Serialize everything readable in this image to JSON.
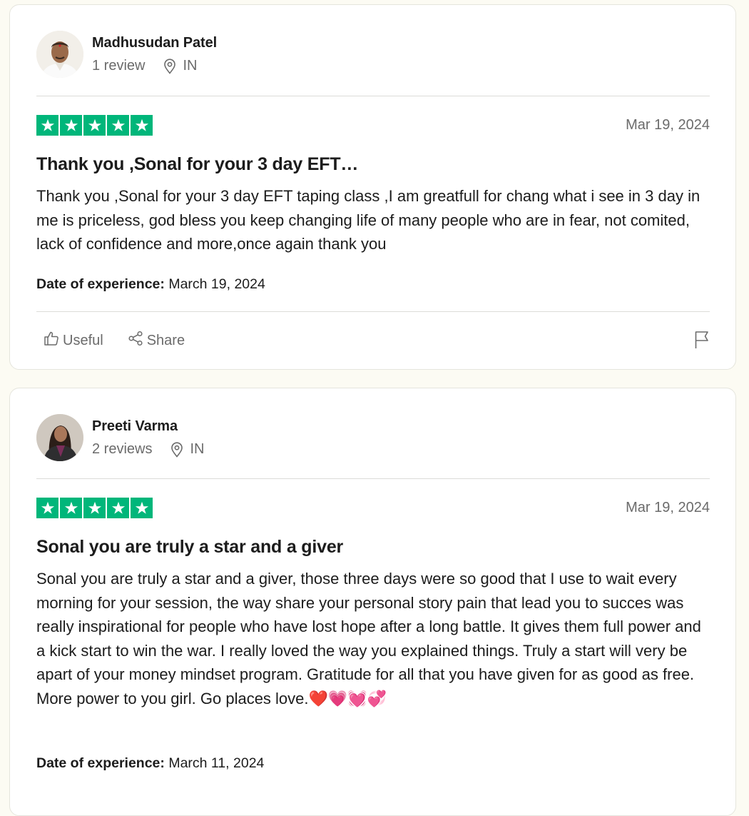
{
  "colors": {
    "star_green": "#00b67a",
    "muted_text": "#6b6b6b",
    "page_bg": "#fcfbf3"
  },
  "icons": {
    "location": "map-pin-icon",
    "useful": "thumbs-up-icon",
    "share": "share-icon",
    "report": "flag-icon",
    "star": "star-icon"
  },
  "reviews": [
    {
      "name": "Madhusudan Patel",
      "review_count": "1 review",
      "country": "IN",
      "rating": 5,
      "date": "Mar 19, 2024",
      "title": "Thank you ,Sonal for your 3 day EFT…",
      "body": "Thank you ,Sonal for your 3 day EFT taping class ,I am greatfull for chang what i see in 3 day in me is priceless, god bless you keep changing life of many people who are in fear, not comited, lack of confidence and more,once again thank you",
      "experience_label": "Date of experience:",
      "experience_date": "March 19, 2024",
      "useful_label": "Useful",
      "share_label": "Share"
    },
    {
      "name": "Preeti Varma",
      "review_count": "2 reviews",
      "country": "IN",
      "rating": 5,
      "date": "Mar 19, 2024",
      "title": "Sonal you are truly a star and a giver",
      "body": "Sonal you are truly a star and a giver, those three days were so good that I use to wait every morning for your session, the way share your personal story pain that lead you to succes was really inspirational for people who have lost hope after a long battle. It gives them full power and a kick start to win the war. I really loved the way you explained things. Truly a start will very be apart of your money mindset program. Gratitude for all that you have given for as good as free. More power to you girl. Go places love.❤️💗💓💞",
      "experience_label": "Date of experience:",
      "experience_date": "March 11, 2024"
    }
  ]
}
